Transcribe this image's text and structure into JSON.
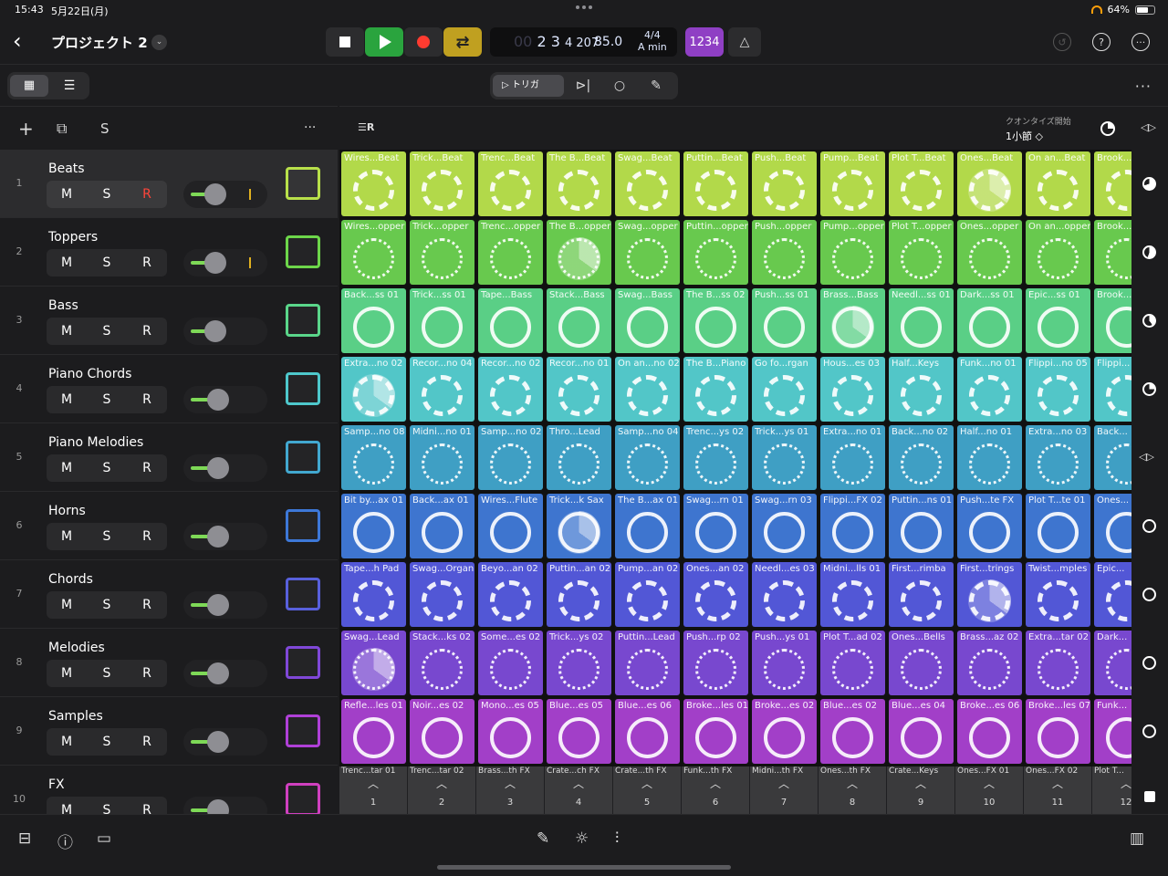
{
  "status": {
    "time": "15:43",
    "date": "5月22日(月)",
    "battery": "64%"
  },
  "project": {
    "title": "プロジェクト 2"
  },
  "transport": {
    "position_dim": "00",
    "position": "2 3",
    "position_sub": "4 207",
    "bpm": "85.0",
    "signature": "4/4",
    "key": "A min",
    "count_in": "1234"
  },
  "mode": {
    "trigger_label": "トリガ"
  },
  "quantize": {
    "label": "クオンタイズ開始",
    "value": "1小節 ◇"
  },
  "track_header": {
    "solo_label": "S"
  },
  "tracks": [
    {
      "num": "1",
      "name": "Beats",
      "m": "M",
      "s": "S",
      "r": "R",
      "vol": 0.45,
      "color": "#b8e04a"
    },
    {
      "num": "2",
      "name": "Toppers",
      "m": "M",
      "s": "S",
      "r": "R",
      "vol": 0.45,
      "color": "#6dd64a"
    },
    {
      "num": "3",
      "name": "Bass",
      "m": "M",
      "s": "S",
      "r": "R",
      "vol": 0.45,
      "color": "#5ad68a"
    },
    {
      "num": "4",
      "name": "Piano Chords",
      "m": "M",
      "s": "S",
      "r": "R",
      "vol": 0.5,
      "color": "#4ec8cc"
    },
    {
      "num": "5",
      "name": "Piano Melodies",
      "m": "M",
      "s": "S",
      "r": "R",
      "vol": 0.5,
      "color": "#42a8d0"
    },
    {
      "num": "6",
      "name": "Horns",
      "m": "M",
      "s": "S",
      "r": "R",
      "vol": 0.5,
      "color": "#3d78d8"
    },
    {
      "num": "7",
      "name": "Chords",
      "m": "M",
      "s": "S",
      "r": "R",
      "vol": 0.5,
      "color": "#5860dc"
    },
    {
      "num": "8",
      "name": "Melodies",
      "m": "M",
      "s": "S",
      "r": "R",
      "vol": 0.5,
      "color": "#8048d8"
    },
    {
      "num": "9",
      "name": "Samples",
      "m": "M",
      "s": "S",
      "r": "R",
      "vol": 0.5,
      "color": "#b040d8"
    },
    {
      "num": "10",
      "name": "FX",
      "m": "M",
      "s": "S",
      "r": "R",
      "vol": 0.5,
      "color": "#d040c0"
    }
  ],
  "row_colors": [
    "#b2d94a",
    "#68c94e",
    "#5acf86",
    "#52c6c8",
    "#3f9fc4",
    "#3e75cf",
    "#5257d6",
    "#7848cf",
    "#a23fc8"
  ],
  "clips": [
    [
      "Wires...Beat",
      "Trick...Beat",
      "Trenc...Beat",
      "The B...Beat",
      "Swag...Beat",
      "Puttin...Beat",
      "Push...Beat",
      "Pump...Beat",
      "Plot T...Beat",
      "Ones...Beat",
      "On an...Beat",
      "Brook..."
    ],
    [
      "Wires...opper",
      "Trick...opper",
      "Trenc...opper",
      "The B...opper",
      "Swag...opper",
      "Puttin...opper",
      "Push...opper",
      "Pump...opper",
      "Plot T...opper",
      "Ones...opper",
      "On an...opper",
      "Brook..."
    ],
    [
      "Back...ss 01",
      "Trick...ss 01",
      "Tape...Bass",
      "Stack...Bass",
      "Swag...Bass",
      "The B...ss 02",
      "Push...ss 01",
      "Brass...Bass",
      "Needl...ss 01",
      "Dark...ss 01",
      "Epic...ss 01",
      "Brook..."
    ],
    [
      "Extra...no 02",
      "Recor...no 04",
      "Recor...no 02",
      "Recor...no 01",
      "On an...no 02",
      "The B...Piano",
      "Go fo...rgan",
      "Hous...es 03",
      "Half...Keys",
      "Funk...no 01",
      "Flippi...no 05",
      "Flippi..."
    ],
    [
      "Samp...no 08",
      "Midni...no 01",
      "Samp...no 02",
      "Thro...Lead",
      "Samp...no 04",
      "Trenc...ys 02",
      "Trick...ys 01",
      "Extra...no 01",
      "Back...no 02",
      "Half...no 01",
      "Extra...no 03",
      "Back..."
    ],
    [
      "Bit by...ax 01",
      "Back...ax 01",
      "Wires...Flute",
      "Trick...k Sax",
      "The B...ax 01",
      "Swag...rn 01",
      "Swag...rn 03",
      "Flippi...FX 02",
      "Puttin...ns 01",
      "Push...te FX",
      "Plot T...te 01",
      "Ones..."
    ],
    [
      "Tape...h Pad",
      "Swag...Organ",
      "Beyo...an 02",
      "Puttin...an 02",
      "Pump...an 02",
      "Ones...an 02",
      "Needl...es 03",
      "Midni...lls 01",
      "First...rimba",
      "First...trings",
      "Twist...mples",
      "Epic..."
    ],
    [
      "Swag...Lead",
      "Stack...ks 02",
      "Some...es 02",
      "Trick...ys 02",
      "Puttin...Lead",
      "Push...rp 02",
      "Push...ys 01",
      "Plot T...ad 02",
      "Ones...Bells",
      "Brass...az 02",
      "Extra...tar 02",
      "Dark..."
    ],
    [
      "Refle...les 01",
      "Noir...es 02",
      "Mono...es 05",
      "Blue...es 05",
      "Blue...es 06",
      "Broke...les 01",
      "Broke...es 02",
      "Blue...es 02",
      "Blue...es 04",
      "Broke...es 06",
      "Broke...les 07",
      "Funk..."
    ]
  ],
  "playing": [
    [
      0,
      9
    ],
    [
      1,
      3
    ],
    [
      2,
      7
    ],
    [
      3,
      0
    ],
    [
      5,
      3
    ],
    [
      6,
      9
    ],
    [
      7,
      0
    ]
  ],
  "fx_row": [
    "Trenc...tar 01",
    "Trenc...tar 02",
    "Brass...th FX",
    "Crate...ch FX",
    "Crate...th FX",
    "Funk...th FX",
    "Midni...th FX",
    "Ones...th FX",
    "Crate...Keys",
    "Ones...FX 01",
    "Ones...FX 02",
    "Plot T..."
  ],
  "scenes": [
    "1",
    "2",
    "3",
    "4",
    "5",
    "6",
    "7",
    "8",
    "9",
    "10",
    "11",
    "12"
  ]
}
